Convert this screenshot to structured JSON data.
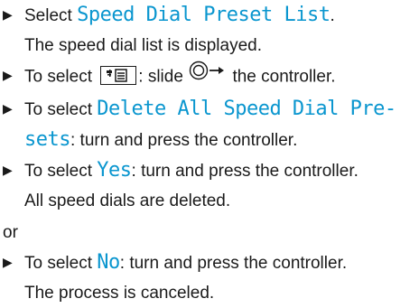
{
  "steps": [
    {
      "pre": "Select ",
      "highlight": "Speed Dial Preset List",
      "post": ".",
      "result": "The speed dial list is displayed."
    },
    {
      "pre": "To select ",
      "icon": "phonebook-list-icon",
      "post": ": slide ",
      "control_icon": "controller-slide-right-icon",
      "post2": " the controller."
    },
    {
      "pre": "To select ",
      "highlight_line1": "Delete All Speed Dial Pre-",
      "highlight_line2": "sets",
      "post": ": turn and press the controller."
    },
    {
      "pre": "To select ",
      "highlight": "Yes",
      "post": ": turn and press the controller.",
      "result": "All speed dials are deleted."
    }
  ],
  "or_label": "or",
  "final_step": {
    "pre": "To select ",
    "highlight": "No",
    "post": ": turn and press the controller.",
    "result": "The process is canceled."
  },
  "bullet_glyph": "▶"
}
